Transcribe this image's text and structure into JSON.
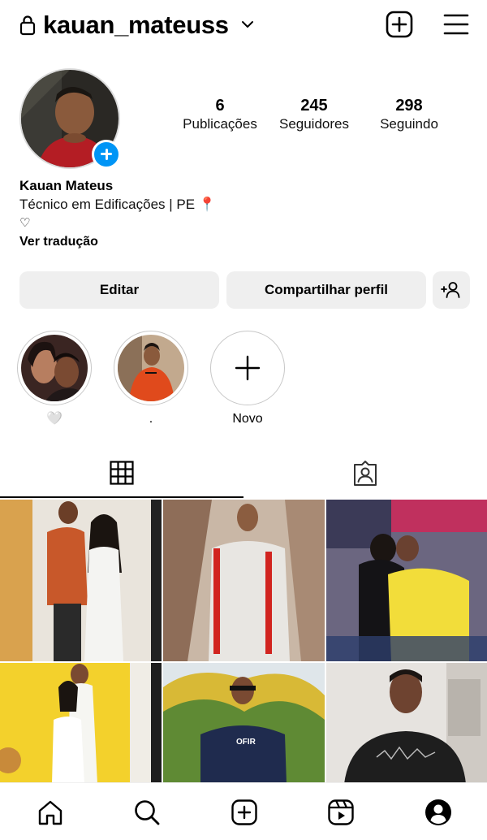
{
  "header": {
    "username": "kauan_mateuss",
    "icons": {
      "lock": "lock-icon",
      "dropdown": "chevron-down-icon",
      "create": "plus-square-icon",
      "menu": "hamburger-menu-icon"
    }
  },
  "profile": {
    "stats": {
      "posts_count": "6",
      "posts_label": "Publicações",
      "followers_count": "245",
      "followers_label": "Seguidores",
      "following_count": "298",
      "following_label": "Seguindo"
    },
    "name": "Kauan Mateus",
    "bio_line": "Técnico em Edificações | PE 📍",
    "bio_heart": "♡",
    "translate_link": "Ver tradução"
  },
  "actions": {
    "edit_label": "Editar",
    "share_label": "Compartilhar perfil",
    "add_user_icon": "add-user-icon"
  },
  "highlights": [
    {
      "label": "🤍"
    },
    {
      "label": "."
    },
    {
      "label": "Novo"
    }
  ],
  "tabs": [
    {
      "icon": "grid-icon",
      "selected": true
    },
    {
      "icon": "tagged-icon",
      "selected": false
    }
  ],
  "posts": [
    {
      "scene": "couple-indoor-white-dress"
    },
    {
      "scene": "man-red-suspenders"
    },
    {
      "scene": "couple-kiss-yellow-shirt"
    },
    {
      "scene": "couple-yellow-wall"
    },
    {
      "scene": "man-palm-trees"
    },
    {
      "scene": "man-black-shirt"
    }
  ],
  "bottom_nav": [
    {
      "icon": "home-icon"
    },
    {
      "icon": "search-icon"
    },
    {
      "icon": "create-icon"
    },
    {
      "icon": "reels-icon"
    },
    {
      "icon": "profile-icon"
    }
  ],
  "colors": {
    "accent": "#0095f6",
    "button_bg": "#efefef",
    "text": "#000000"
  }
}
